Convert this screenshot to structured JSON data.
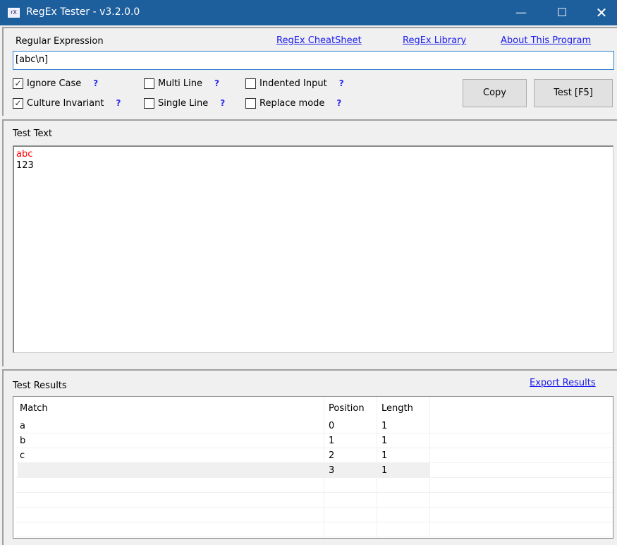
{
  "window": {
    "title": "RegEx Tester - v3.2.0.0",
    "icon": "rX",
    "controls": [
      "minimize",
      "maximize",
      "close"
    ]
  },
  "regex": {
    "label": "Regular Expression",
    "value": "[abc\\n]",
    "links": [
      "RegEx CheatSheet",
      "RegEx Library",
      "About This Program"
    ]
  },
  "options": [
    {
      "label": "Ignore Case",
      "checked": true
    },
    {
      "label": "Culture Invariant",
      "checked": true
    },
    {
      "label": "Multi Line",
      "checked": false
    },
    {
      "label": "Single Line",
      "checked": false
    },
    {
      "label": "Indented Input",
      "checked": false
    },
    {
      "label": "Replace mode",
      "checked": false
    }
  ],
  "help": "?",
  "buttons": {
    "copy": "Copy",
    "test": "Test [F5]"
  },
  "test_text": {
    "label": "Test Text",
    "lines": [
      "abc",
      "123"
    ],
    "match_color": "#ff0000"
  },
  "results": {
    "label": "Test Results",
    "export": "Export Results",
    "columns": [
      "Match",
      "Position",
      "Length"
    ],
    "rows": [
      [
        "a",
        "0",
        "1"
      ],
      [
        "b",
        "1",
        "1"
      ],
      [
        "c",
        "2",
        "1"
      ],
      [
        "",
        "3",
        "1"
      ]
    ],
    "selected_row": 3
  }
}
